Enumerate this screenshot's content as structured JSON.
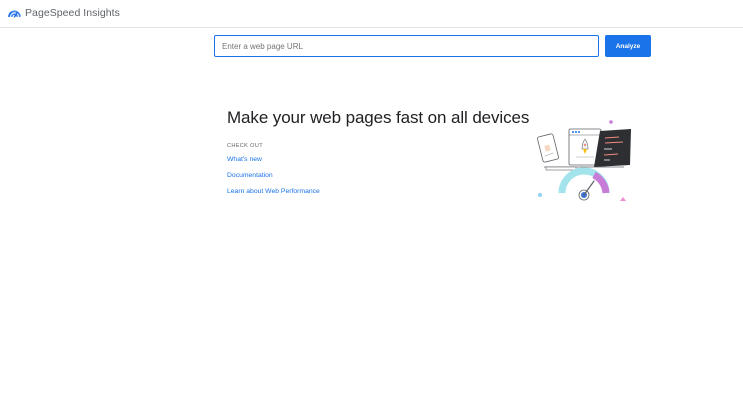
{
  "header": {
    "app_title": "PageSpeed Insights",
    "logo_icon": "pagespeed-gauge-icon"
  },
  "search": {
    "value": "",
    "placeholder": "Enter a web page URL",
    "analyze_label": "Analyze"
  },
  "main": {
    "headline": "Make your web pages fast on all devices",
    "checkout_label": "CHECK OUT",
    "links": [
      {
        "label": "What's new"
      },
      {
        "label": "Documentation"
      },
      {
        "label": "Learn about Web Performance"
      }
    ],
    "illustration_icon": "devices-speed-gauge-illustration"
  },
  "colors": {
    "accent": "#1a73e8",
    "text": "#202124",
    "muted": "#5f6368",
    "gauge_purple": "#c77dd8",
    "gauge_cyan": "#a3e3ec",
    "gauge_blue": "#3b6fd4"
  }
}
